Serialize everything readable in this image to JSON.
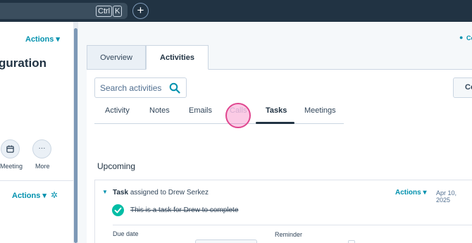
{
  "topbar": {
    "shortcut_ctrl": "Ctrl",
    "shortcut_k": "K",
    "add_symbol": "+"
  },
  "left_panel": {
    "actions_label": "Actions",
    "record_title": "guration",
    "meeting_label": "Meeting",
    "more_label": "More",
    "actions_label_2": "Actions"
  },
  "header": {
    "corner_label": "Co"
  },
  "tabs": [
    {
      "label": "Overview",
      "active": false
    },
    {
      "label": "Activities",
      "active": true
    }
  ],
  "activity_search": {
    "placeholder": "Search activities"
  },
  "right_button_label": "Co",
  "subtabs": [
    {
      "label": "Activity",
      "active": false
    },
    {
      "label": "Notes",
      "active": false
    },
    {
      "label": "Emails",
      "active": false
    },
    {
      "label": "Calls",
      "active": false
    },
    {
      "label": "Tasks",
      "active": true
    },
    {
      "label": "Meetings",
      "active": false
    }
  ],
  "section": {
    "upcoming_label": "Upcoming"
  },
  "task": {
    "type": "Task",
    "assigned_text": "assigned to Drew Serkez",
    "actions_label": "Actions",
    "date": "Apr 10, 2025",
    "description": "This is a task for Drew to complete",
    "due_date_label": "Due date",
    "reminder_label": "Reminder"
  },
  "colors": {
    "topbar": "#213343",
    "accent": "#0091ae",
    "complete": "#00bda5",
    "click_highlight": "#e0468f"
  }
}
